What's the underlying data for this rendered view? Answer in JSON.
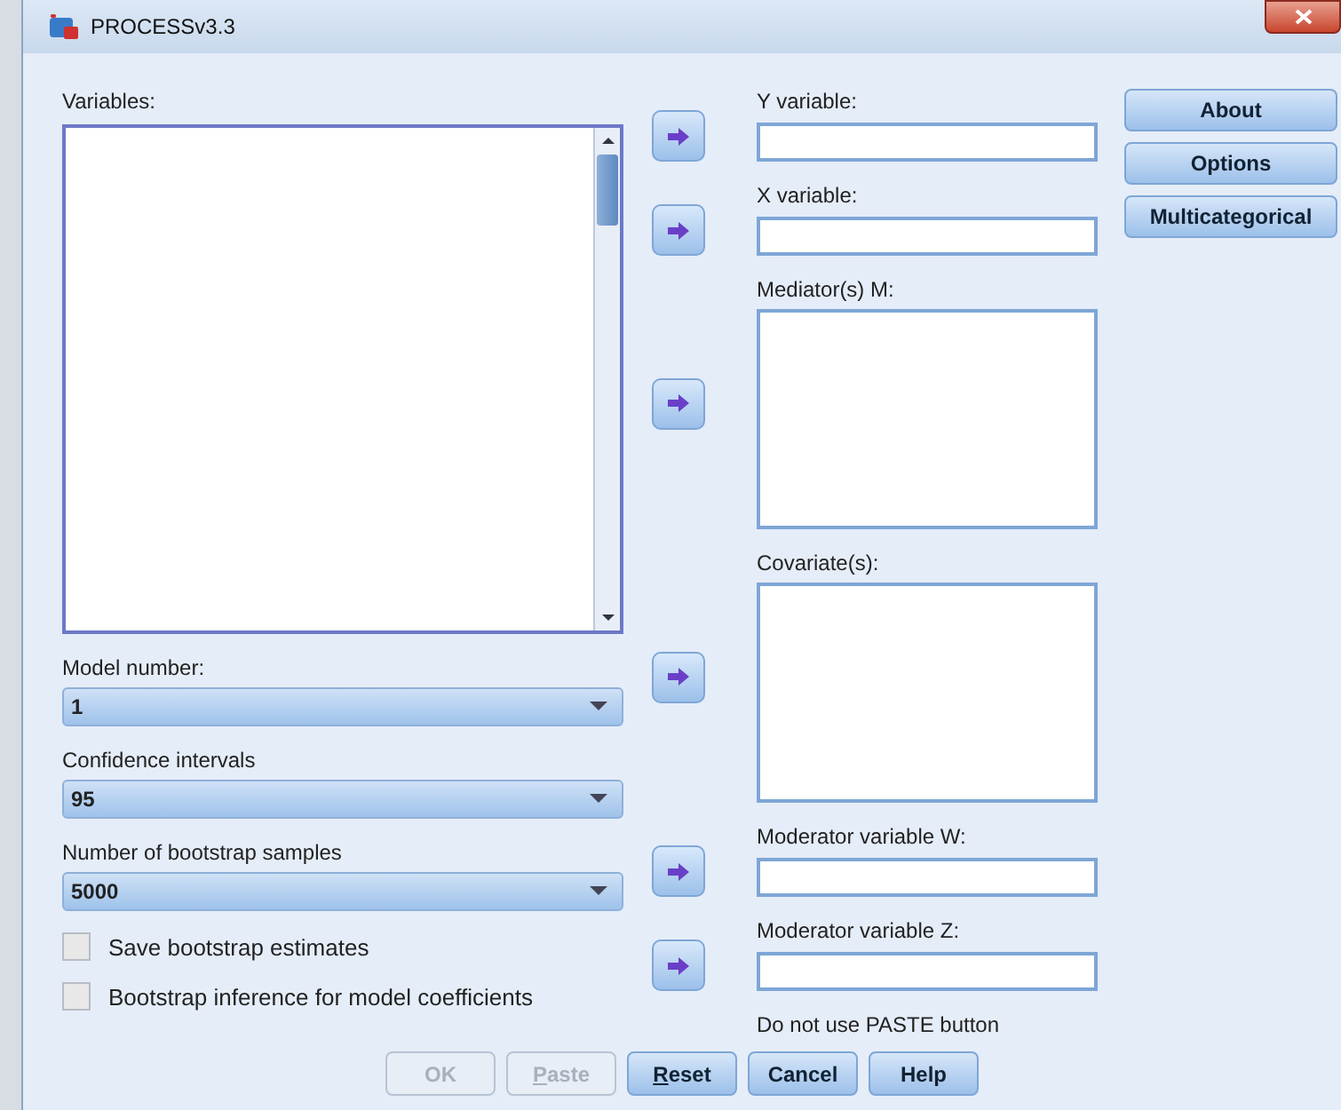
{
  "window": {
    "title": "PROCESSv3.3"
  },
  "variables": {
    "label": "Variables:"
  },
  "settings": [
    {
      "label": "Model number:",
      "value": "1"
    },
    {
      "label": "Confidence intervals",
      "value": "95"
    },
    {
      "label": "Number of bootstrap samples",
      "value": "5000"
    }
  ],
  "checkboxes": [
    {
      "label": "Save bootstrap estimates",
      "checked": false
    },
    {
      "label": "Bootstrap inference for model coefficients",
      "checked": false
    }
  ],
  "targets": [
    {
      "label": "Y variable:",
      "kind": "field"
    },
    {
      "label": "X variable:",
      "kind": "field"
    },
    {
      "label": "Mediator(s) M:",
      "kind": "list"
    },
    {
      "label": "Covariate(s):",
      "kind": "list"
    },
    {
      "label": "Moderator variable W:",
      "kind": "field"
    },
    {
      "label": "Moderator variable Z:",
      "kind": "field"
    }
  ],
  "note": "Do not use PASTE button",
  "side_buttons": [
    "About",
    "Options",
    "Multicategorical"
  ],
  "buttons": [
    {
      "label": "OK",
      "disabled": true,
      "underline_first": false
    },
    {
      "label": "Paste",
      "disabled": true,
      "underline_first": true
    },
    {
      "label": "Reset",
      "disabled": false,
      "underline_first": true
    },
    {
      "label": "Cancel",
      "disabled": false,
      "underline_first": false
    },
    {
      "label": "Help",
      "disabled": false,
      "underline_first": false
    }
  ]
}
